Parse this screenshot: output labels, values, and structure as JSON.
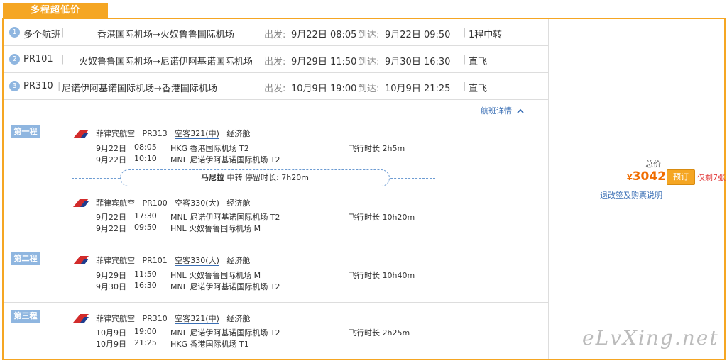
{
  "tab_label": "多程超低价",
  "summary": [
    {
      "num": "1",
      "flight": "多个航班",
      "route": "香港国际机场→火奴鲁鲁国际机场",
      "dep_label": "出发:",
      "dep_time": "9月22日 08:05",
      "arr_label": "到达:",
      "arr_time": "9月22日 09:50",
      "stops": "1程中转"
    },
    {
      "num": "2",
      "flight": "PR101",
      "route": "火奴鲁鲁国际机场→尼诺伊阿基诺国际机场",
      "dep_label": "出发:",
      "dep_time": "9月29日 11:50",
      "arr_label": "到达:",
      "arr_time": "9月30日 16:30",
      "stops": "直飞"
    },
    {
      "num": "3",
      "flight": "PR310",
      "route": "尼诺伊阿基诺国际机场→香港国际机场",
      "dep_label": "出发:",
      "dep_time": "10月9日 19:00",
      "arr_label": "到达:",
      "arr_time": "10月9日 21:25",
      "stops": "直飞"
    }
  ],
  "detail_link": "航班详情",
  "segments": [
    {
      "label": "第一程",
      "flights": [
        {
          "airline": "菲律宾航空",
          "no": "PR313",
          "plane": "空客321(中)",
          "cabin": "经济舱",
          "dep_date": "9月22日",
          "dep_time": "08:05",
          "dep_airport": "HKG 香港国际机场 T2",
          "arr_date": "9月22日",
          "arr_time": "10:10",
          "arr_airport": "MNL 尼诺伊阿基诺国际机场 T2",
          "duration": "飞行时长 2h5m"
        },
        {
          "airline": "菲律宾航空",
          "no": "PR100",
          "plane": "空客330(大)",
          "cabin": "经济舱",
          "dep_date": "9月22日",
          "dep_time": "17:30",
          "dep_airport": "MNL 尼诺伊阿基诺国际机场 T2",
          "arr_date": "9月22日",
          "arr_time": "09:50",
          "arr_airport": "HNL 火奴鲁鲁国际机场 M",
          "duration": "飞行时长 10h20m"
        }
      ],
      "stopover": {
        "city": "马尼拉",
        "text1": "中转",
        "text2": "停留时长: 7h20m"
      }
    },
    {
      "label": "第二程",
      "flights": [
        {
          "airline": "菲律宾航空",
          "no": "PR101",
          "plane": "空客330(大)",
          "cabin": "经济舱",
          "dep_date": "9月29日",
          "dep_time": "11:50",
          "dep_airport": "HNL 火奴鲁鲁国际机场 M",
          "arr_date": "9月30日",
          "arr_time": "16:30",
          "arr_airport": "MNL 尼诺伊阿基诺国际机场 T2",
          "duration": "飞行时长 10h40m"
        }
      ]
    },
    {
      "label": "第三程",
      "flights": [
        {
          "airline": "菲律宾航空",
          "no": "PR310",
          "plane": "空客321(中)",
          "cabin": "经济舱",
          "dep_date": "10月9日",
          "dep_time": "19:00",
          "dep_airport": "MNL 尼诺伊阿基诺国际机场 T2",
          "arr_date": "10月9日",
          "arr_time": "21:25",
          "arr_airport": "HKG 香港国际机场 T1",
          "duration": "飞行时长 2h25m"
        }
      ]
    }
  ],
  "price_panel": {
    "total_label": "总价",
    "currency": "¥",
    "amount": "3042",
    "book_label": "预订",
    "remaining": "仅剩7张",
    "policy_link": "退改签及购票说明"
  },
  "watermark": "eLvXing.net",
  "colors": {
    "accent": "#f5a623",
    "link": "#3a6fb5",
    "price": "#f06d00",
    "badge": "#8fb6e0",
    "airline_red": "#d22b2b",
    "airline_blue": "#1e3d8f"
  }
}
